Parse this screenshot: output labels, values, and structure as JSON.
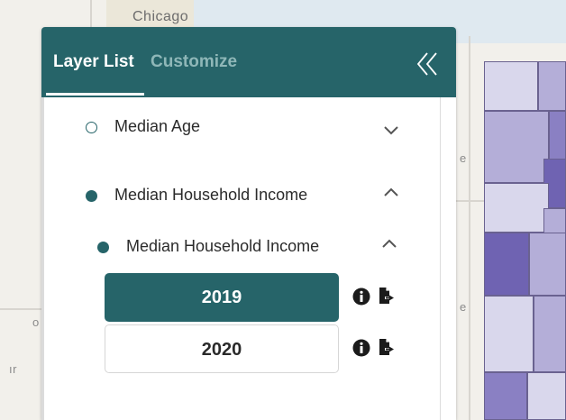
{
  "map": {
    "labels": {
      "city": "Chicago",
      "edge_e1": "e",
      "edge_e2": "e",
      "edge_o": "o",
      "edge_ir": "ır"
    },
    "choropleth_colors": [
      "#d9d7ec",
      "#b4aed8",
      "#8a80c3",
      "#6f63b2"
    ]
  },
  "panel": {
    "tabs": [
      {
        "label": "Layer List",
        "active": true
      },
      {
        "label": "Customize",
        "active": false
      }
    ],
    "collapse_icon": "double-chevron-left-icon",
    "accent_color": "#266469"
  },
  "layers": [
    {
      "name": "Median Age",
      "selected": false,
      "expanded": false
    },
    {
      "name": "Median Household Income",
      "selected": true,
      "expanded": true,
      "sublayers": [
        {
          "name": "Median Household Income",
          "selected": true,
          "expanded": true,
          "years": [
            {
              "label": "2019",
              "active": true
            },
            {
              "label": "2020",
              "active": false
            }
          ]
        }
      ]
    }
  ],
  "icons": {
    "info": "info-icon",
    "export": "export-file-icon",
    "expand": "chevron-down-icon",
    "collapse": "chevron-up-icon"
  }
}
